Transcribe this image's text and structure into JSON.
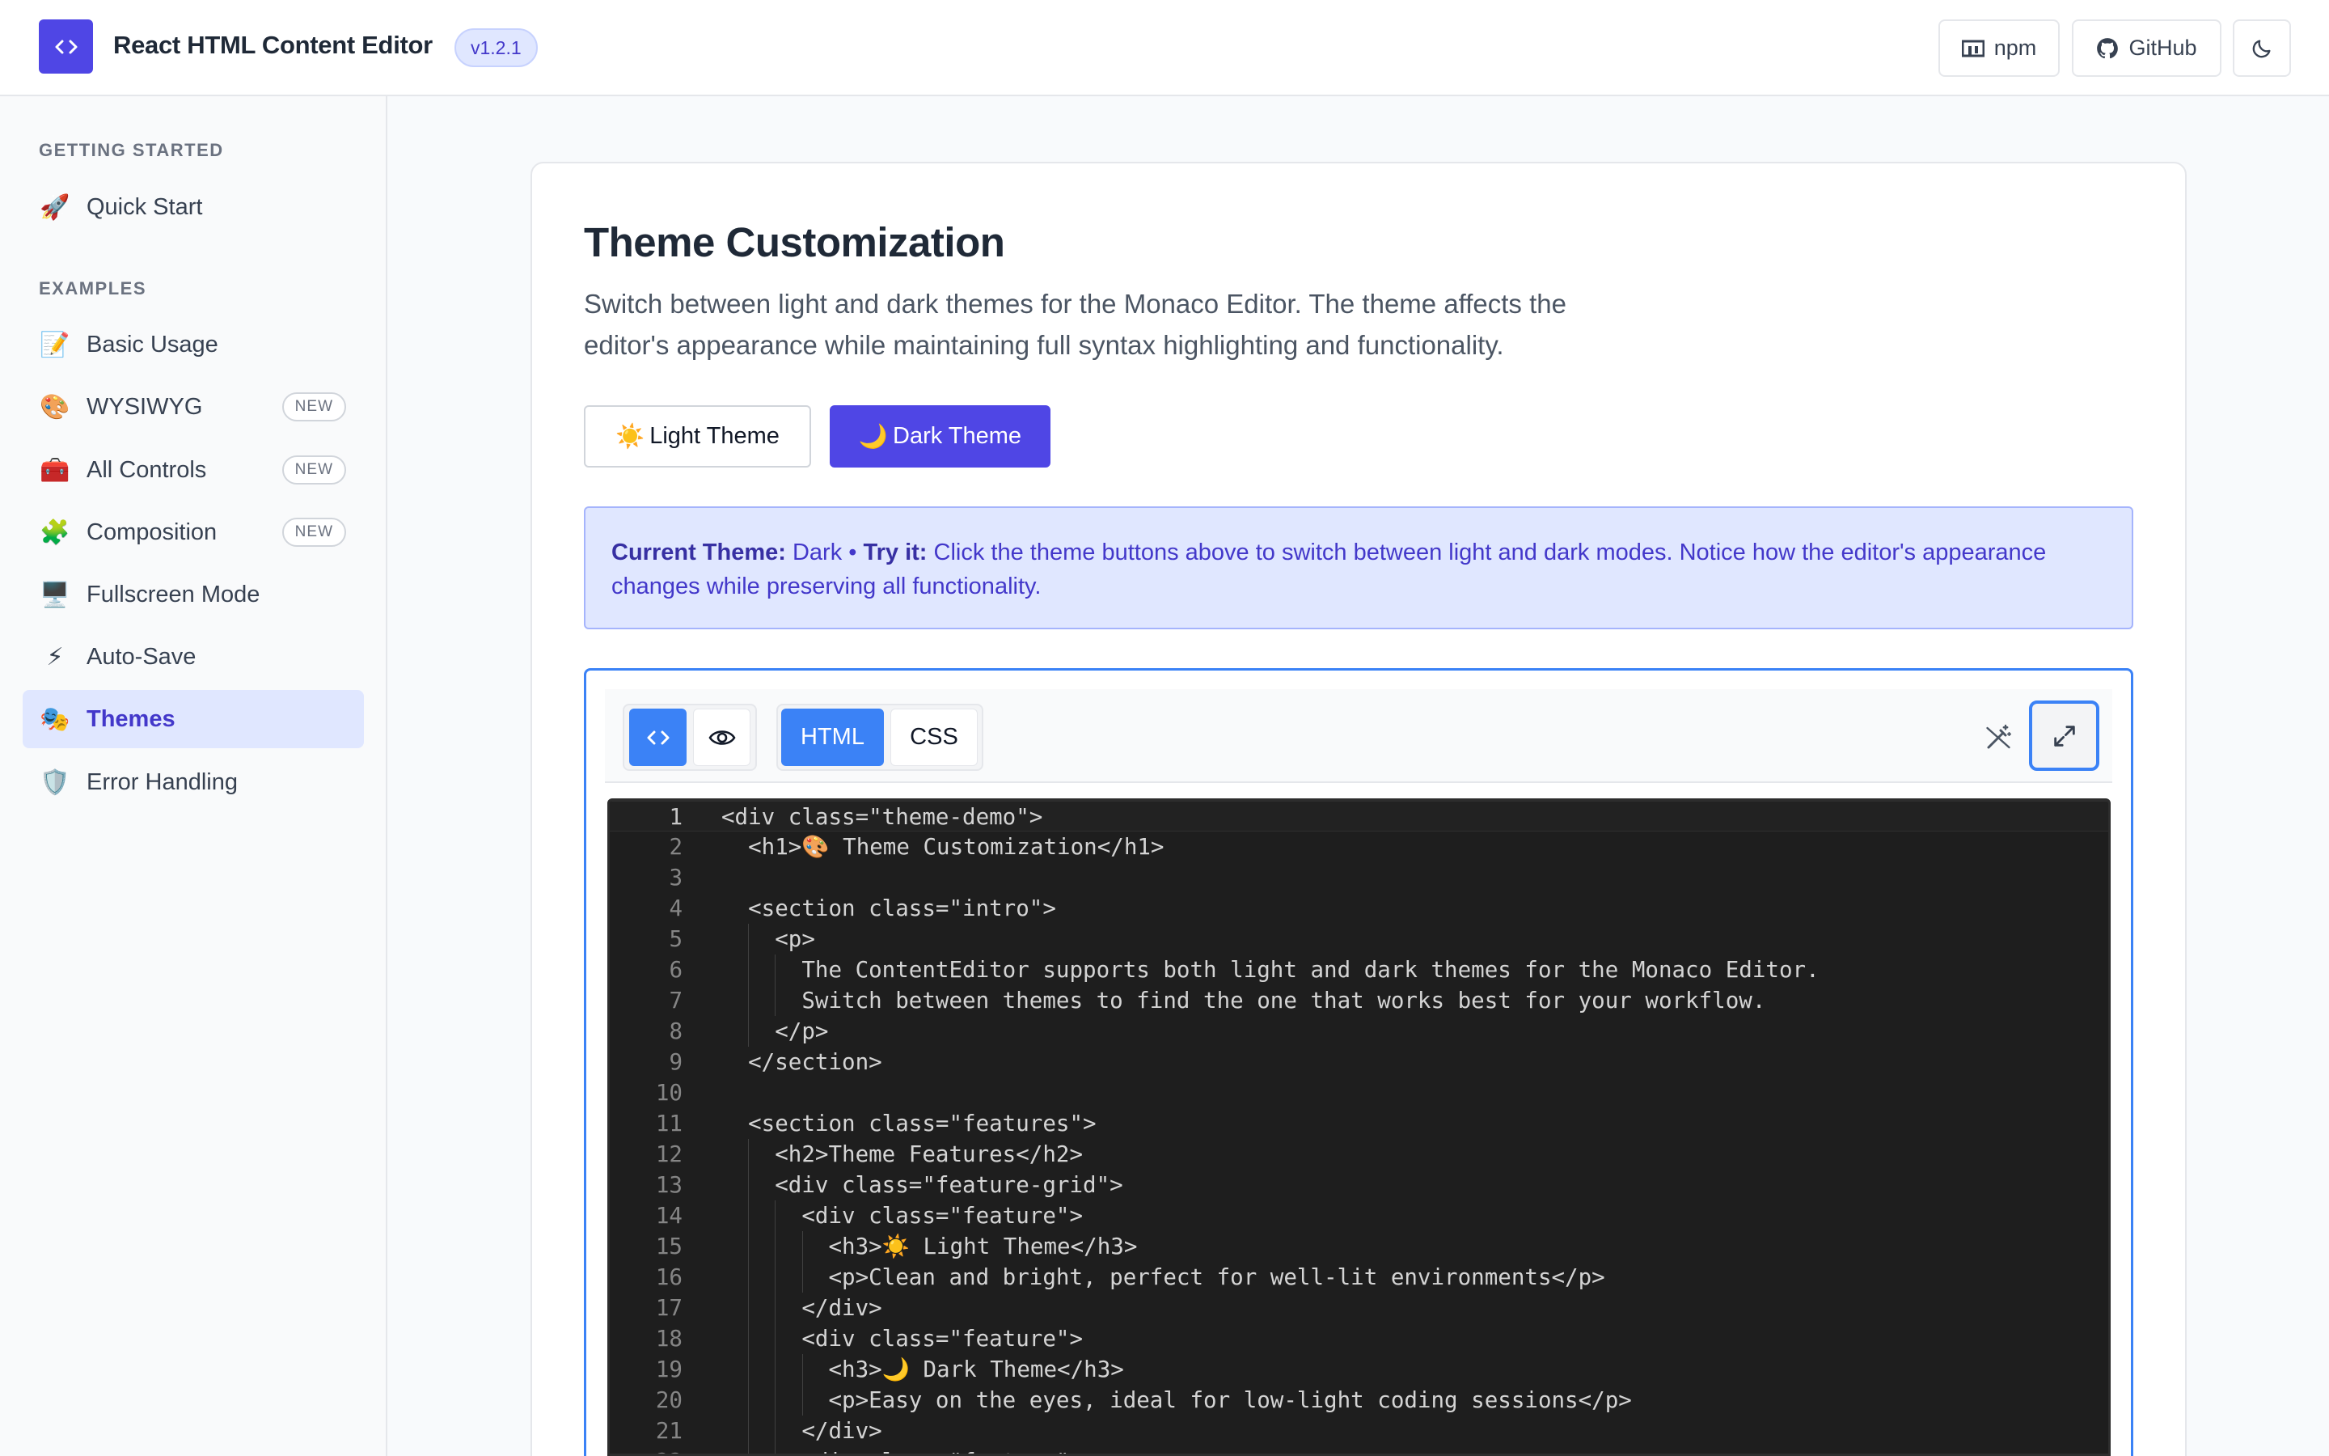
{
  "header": {
    "logo_glyph": "‹›",
    "title": "React HTML Content Editor",
    "version": "v1.2.1",
    "npm_label": "npm",
    "github_label": "GitHub",
    "theme_toggle_icon": "moon-icon"
  },
  "sidebar": {
    "sections": [
      {
        "label": "GETTING STARTED",
        "items": [
          {
            "emoji": "🚀",
            "label": "Quick Start"
          }
        ]
      },
      {
        "label": "EXAMPLES",
        "items": [
          {
            "emoji": "📝",
            "label": "Basic Usage"
          },
          {
            "emoji": "🎨",
            "label": "WYSIWYG",
            "badge": "NEW"
          },
          {
            "emoji": "🧰",
            "label": "All Controls",
            "badge": "NEW"
          },
          {
            "emoji": "🧩",
            "label": "Composition",
            "badge": "NEW"
          },
          {
            "emoji": "🖥️",
            "label": "Fullscreen Mode"
          },
          {
            "emoji": "⚡",
            "label": "Auto-Save"
          },
          {
            "emoji": "🎭",
            "label": "Themes",
            "active": true
          },
          {
            "emoji": "🛡️",
            "label": "Error Handling"
          }
        ]
      }
    ]
  },
  "main": {
    "title": "Theme Customization",
    "description": "Switch between light and dark themes for the Monaco Editor. The theme affects the editor's appearance while maintaining full syntax highlighting and functionality.",
    "buttons": {
      "light": {
        "emoji": "☀️",
        "label": "Light Theme"
      },
      "dark": {
        "emoji": "🌙",
        "label": "Dark Theme"
      }
    },
    "info": {
      "current_label": "Current Theme:",
      "current_value": "Dark",
      "separator": "•",
      "try_label": "Try it:",
      "try_text": "Click the theme buttons above to switch between light and dark modes. Notice how the editor's appearance changes while preserving all functionality."
    }
  },
  "editor": {
    "toolbar": {
      "code_view_icon": "code-icon",
      "preview_icon": "eye-icon",
      "tab_html": "HTML",
      "tab_css": "CSS",
      "format_icon": "magic-wand-icon",
      "fullscreen_icon": "expand-icon",
      "active_mode": "code",
      "active_tab": "HTML"
    },
    "current_line": 1,
    "lines": [
      "<div class=\"theme-demo\">",
      "  <h1>🎨 Theme Customization</h1>",
      "",
      "  <section class=\"intro\">",
      "    <p>",
      "      The ContentEditor supports both light and dark themes for the Monaco Editor.",
      "      Switch between themes to find the one that works best for your workflow.",
      "    </p>",
      "  </section>",
      "",
      "  <section class=\"features\">",
      "    <h2>Theme Features</h2>",
      "    <div class=\"feature-grid\">",
      "      <div class=\"feature\">",
      "        <h3>☀️ Light Theme</h3>",
      "        <p>Clean and bright, perfect for well-lit environments</p>",
      "      </div>",
      "      <div class=\"feature\">",
      "        <h3>🌙 Dark Theme</h3>",
      "        <p>Easy on the eyes, ideal for low-light coding sessions</p>",
      "      </div>",
      "      <div class=\"feature\">"
    ]
  },
  "colors": {
    "brand": "#4f46e5",
    "accent_blue": "#3b82f6",
    "active_nav_bg": "#e0e7ff",
    "editor_bg": "#1e1e1e"
  }
}
